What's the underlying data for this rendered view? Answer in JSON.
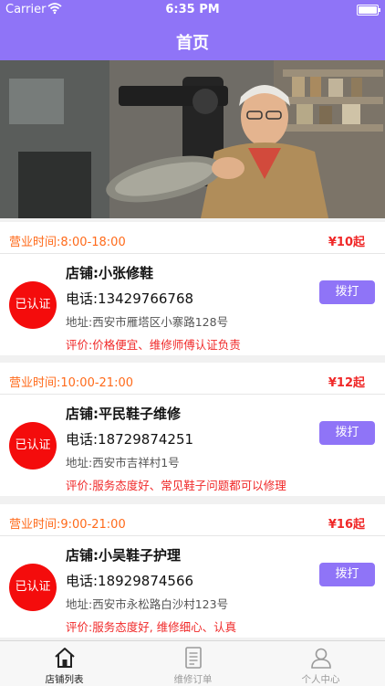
{
  "status_bar": {
    "carrier": "Carrier",
    "time": "6:35 PM"
  },
  "nav": {
    "title": "首页"
  },
  "colors": {
    "accent": "#8f74f7",
    "badge": "#f40c0c",
    "hours": "#ff6a1a",
    "price": "#f02828"
  },
  "shops": [
    {
      "hours": "营业时间:8:00-18:00",
      "price": "¥10起",
      "badge": "已认证",
      "name": "店铺:小张修鞋",
      "phone": "电话:13429766768",
      "address": "地址:西安市雁塔区小寨路128号",
      "review": "评价:价格便宜、维修师傅认证负责",
      "call_label": "拨打"
    },
    {
      "hours": "营业时间:10:00-21:00",
      "price": "¥12起",
      "badge": "已认证",
      "name": "店铺:平民鞋子维修",
      "phone": "电话:18729874251",
      "address": "地址:西安市吉祥村1号",
      "review": "评价:服务态度好、常见鞋子问题都可以修理",
      "call_label": "拨打"
    },
    {
      "hours": "营业时间:9:00-21:00",
      "price": "¥16起",
      "badge": "已认证",
      "name": "店铺:小吴鞋子护理",
      "phone": "电话:18929874566",
      "address": "地址:西安市永松路白沙村123号",
      "review": "评价:服务态度好, 维修细心、认真",
      "call_label": "拨打"
    }
  ],
  "tabs": [
    {
      "label": "店铺列表",
      "icon": "home-icon",
      "active": true
    },
    {
      "label": "维修订单",
      "icon": "document-icon",
      "active": false
    },
    {
      "label": "个人中心",
      "icon": "person-icon",
      "active": false
    }
  ]
}
